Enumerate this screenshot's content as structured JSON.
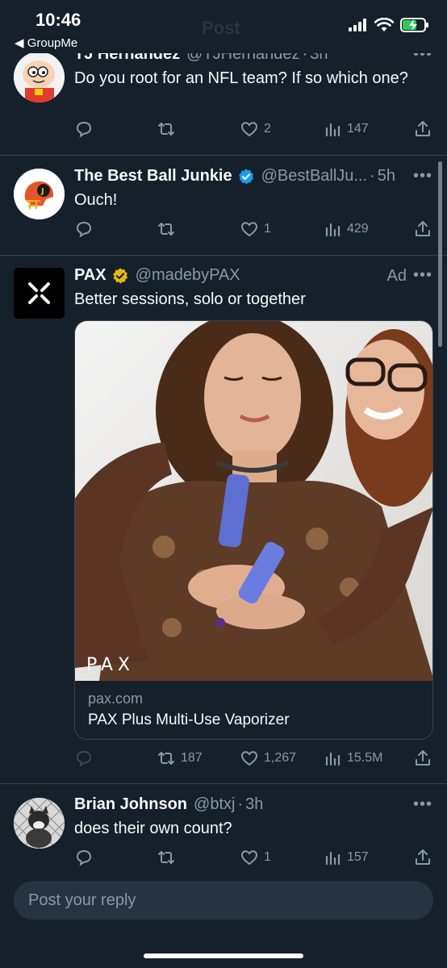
{
  "status_bar": {
    "time": "10:46",
    "back_app": "◀ GroupMe"
  },
  "header": {
    "title_faded": "Post"
  },
  "tweets": [
    {
      "display_name": "TJ Hernandez",
      "handle": "@TJHernandez",
      "time": "3h",
      "text": "Do you root for an NFL team? If so which one?",
      "replies": "",
      "reposts": "",
      "likes": "2",
      "views": "147"
    },
    {
      "display_name": "The Best Ball Junkie",
      "handle": "@BestBallJu...",
      "time": "5h",
      "text": "Ouch!",
      "replies": "",
      "reposts": "",
      "likes": "1",
      "views": "429"
    },
    {
      "display_name": "PAX",
      "handle": "@madebyPAX",
      "ad_label": "Ad",
      "text": "Better sessions, solo or together",
      "card_domain": "pax.com",
      "card_title": "PAX Plus Multi-Use Vaporizer",
      "image_brand": "PAX",
      "reposts": "187",
      "likes": "1,267",
      "views": "15.5M"
    },
    {
      "display_name": "Brian Johnson",
      "handle": "@btxj",
      "time": "3h",
      "text": "does their own count?",
      "likes": "1",
      "views": "157"
    }
  ],
  "reply": {
    "placeholder": "Post your reply"
  },
  "colors": {
    "background": "#15202b",
    "verified_blue": "#1d9bf0",
    "verified_gold": "#e2b719",
    "muted": "#8b98a5"
  }
}
